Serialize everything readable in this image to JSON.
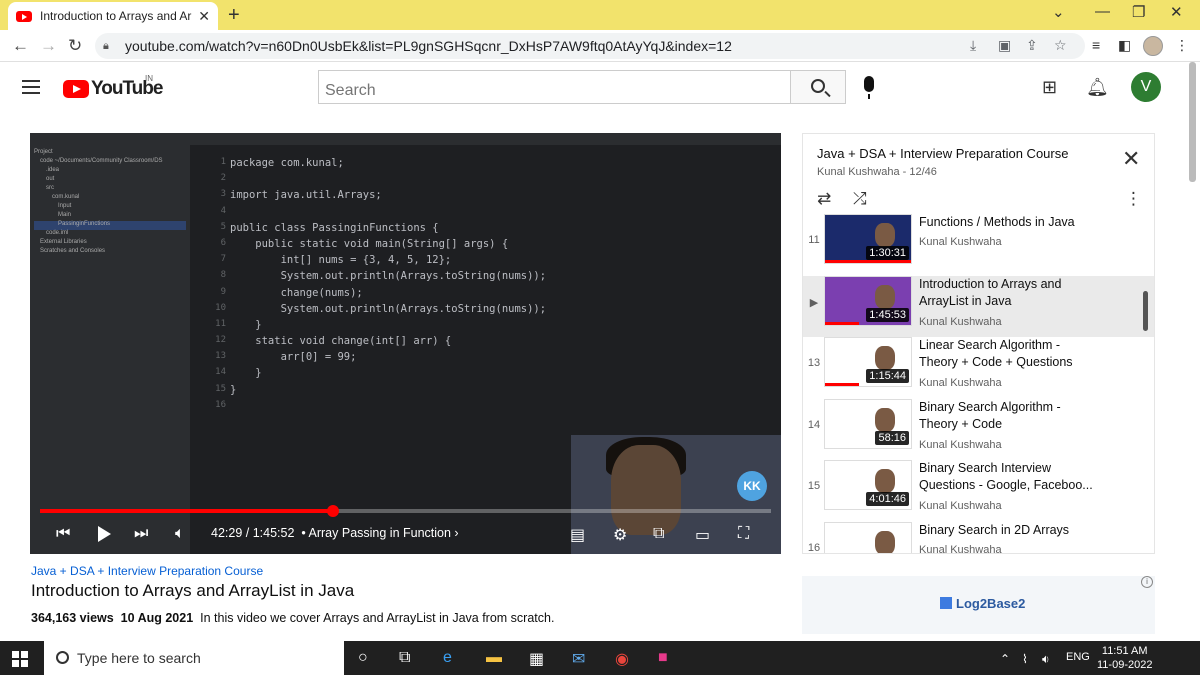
{
  "browser": {
    "tab_title": "Introduction to Arrays and ArrayL",
    "tab_close": "✕",
    "new_tab": "+",
    "url": "youtube.com/watch?v=n60Dn0UsbEk&list=PL9gnSGHSqcnr_DxHsP7AW9ftq0AtAyYqJ&index=12"
  },
  "header": {
    "logo_text": "YouTube",
    "country": "IN",
    "search_placeholder": "Search",
    "user_initial": "V"
  },
  "player": {
    "time": "42:29 / 1:45:52",
    "chapter": "• Array Passing in Function",
    "progress_fraction": 0.4013,
    "channel_badge": "KK",
    "code_lines": [
      {
        "n": "1",
        "t": "package com.kunal;"
      },
      {
        "n": "2",
        "t": ""
      },
      {
        "n": "3",
        "t": "import java.util.Arrays;"
      },
      {
        "n": "4",
        "t": ""
      },
      {
        "n": "5",
        "t": "public class PassinginFunctions {"
      },
      {
        "n": "6",
        "t": "    public static void main(String[] args) {"
      },
      {
        "n": "7",
        "t": "        int[] nums = {3, 4, 5, 12};"
      },
      {
        "n": "8",
        "t": "        System.out.println(Arrays.toString(nums));"
      },
      {
        "n": "9",
        "t": "        change(nums);"
      },
      {
        "n": "10",
        "t": "        System.out.println(Arrays.toString(nums));"
      },
      {
        "n": "11",
        "t": "    }"
      },
      {
        "n": "12",
        "t": "    static void change(int[] arr) {"
      },
      {
        "n": "13",
        "t": "        arr[0] = 99;"
      },
      {
        "n": "14",
        "t": "    }"
      },
      {
        "n": "15",
        "t": "}"
      },
      {
        "n": "16",
        "t": ""
      }
    ],
    "tree": [
      "Project",
      "code ~/Documents/Community Classroom/DS",
      ".idea",
      "out",
      "src",
      "com.kunal",
      "Input",
      "Main",
      "PassinginFunctions",
      "code.iml",
      "External Libraries",
      "Scratches and Consoles"
    ]
  },
  "video": {
    "playlist_link": "Java + DSA + Interview Preparation Course",
    "title": "Introduction to Arrays and ArrayList in Java",
    "views": "364,163 views",
    "date": "10 Aug 2021",
    "description": "In this video we cover Arrays and ArrayList in Java from scratch."
  },
  "playlist": {
    "title": "Java + DSA + Interview Preparation Course",
    "subtitle": "Kunal Kushwaha - 12/46",
    "items": [
      {
        "index": "11",
        "title": "Functions / Methods in Java",
        "channel": "Kunal Kushwaha",
        "duration": "1:30:31",
        "thumb_color": "#1b2a6b",
        "watched": 1.0,
        "active": false
      },
      {
        "index": "▶",
        "title": "Introduction to Arrays and ArrayList in Java",
        "channel": "Kunal Kushwaha",
        "duration": "1:45:53",
        "thumb_color": "#7b3fb0",
        "watched": 0.4,
        "active": true
      },
      {
        "index": "13",
        "title": "Linear Search Algorithm - Theory + Code + Questions",
        "channel": "Kunal Kushwaha",
        "duration": "1:15:44",
        "thumb_color": "#ffffff",
        "watched": 0.4,
        "active": false
      },
      {
        "index": "14",
        "title": "Binary Search Algorithm - Theory + Code",
        "channel": "Kunal Kushwaha",
        "duration": "58:16",
        "thumb_color": "#ffffff",
        "watched": 0,
        "active": false
      },
      {
        "index": "15",
        "title": "Binary Search Interview Questions - Google, Faceboo...",
        "channel": "Kunal Kushwaha",
        "duration": "4:01:46",
        "thumb_color": "#ffffff",
        "watched": 0,
        "active": false
      },
      {
        "index": "16",
        "title": "Binary Search in 2D Arrays",
        "channel": "Kunal Kushwaha",
        "duration": "",
        "thumb_color": "#ffffff",
        "watched": 0,
        "active": false
      }
    ]
  },
  "ad": {
    "brand": "Log2Base2"
  },
  "taskbar": {
    "search_placeholder": "Type here to search",
    "lang": "ENG",
    "time": "11:51 AM",
    "date": "11-09-2022"
  }
}
